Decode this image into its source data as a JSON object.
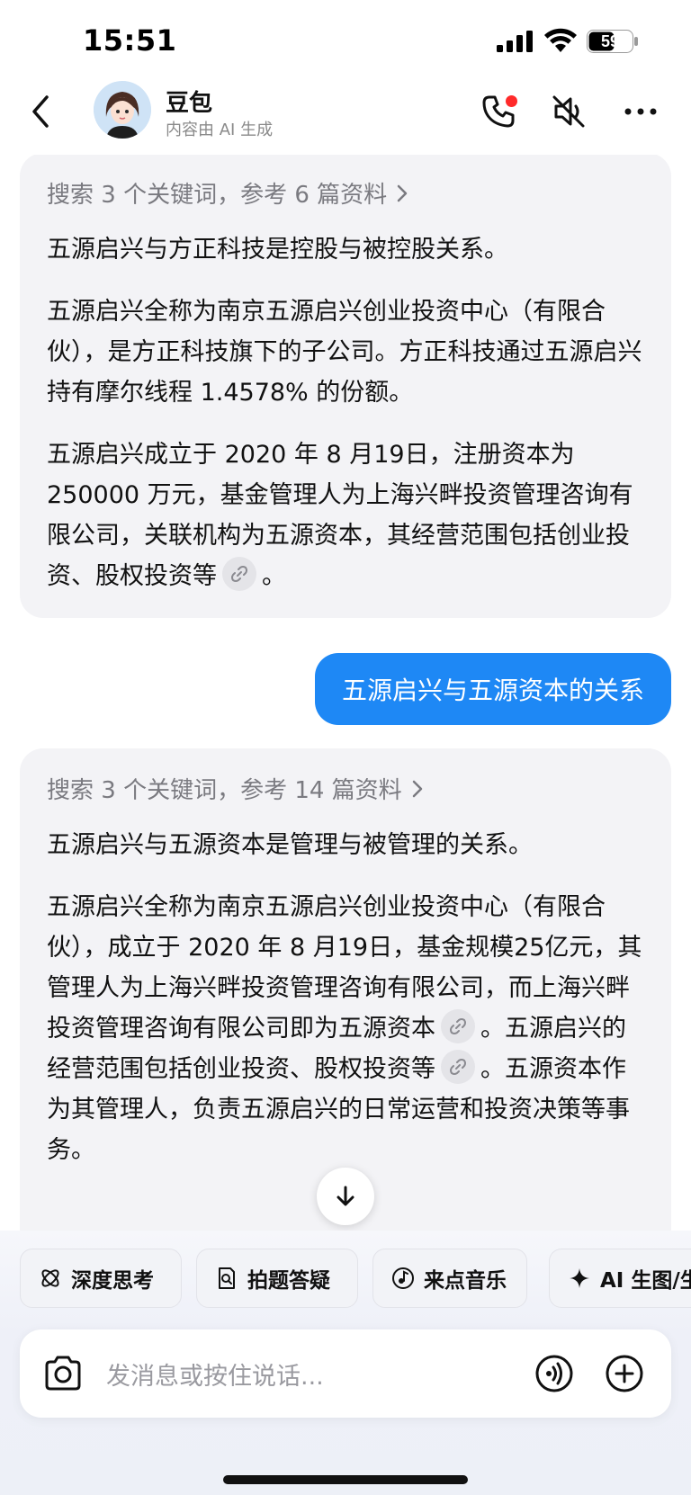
{
  "status_bar": {
    "time": "15:51",
    "battery": "59"
  },
  "header": {
    "name": "豆包",
    "subtitle": "内容由 AI 生成"
  },
  "messages": {
    "ai1": {
      "search": "搜索 3 个关键词，参考 6 篇资料",
      "p1": "五源启兴与方正科技是控股与被控股关系。",
      "p2": "五源启兴全称为南京五源启兴创业投资中心（有限合伙），是方正科技旗下的子公司。方正科技通过五源启兴持有摩尔线程 1.4578% 的份额。",
      "p3": "五源启兴成立于 2020 年 8 月19日，注册资本为250000 万元，基金管理人为上海兴畔投资管理咨询有限公司，关联机构为五源资本，其经营范围包括创业投资、股权投资等",
      "p3_end": "。"
    },
    "user1": "五源启兴与五源资本的关系",
    "ai2": {
      "search": "搜索 3 个关键词，参考 14 篇资料",
      "p1": "五源启兴与五源资本是管理与被管理的关系。",
      "p2a": "五源启兴全称为南京五源启兴创业投资中心（有限合伙），成立于 2020 年 8 月19日，基金规模25亿元，其管理人为上海兴畔投资管理咨询有限公司，而上海兴畔投资管理咨询有限公司即为五源资本",
      "p2b": "。五源启兴的经营范围包括创业投资、股权投资等",
      "p2c": "。五源资本作为其管理人，负责五源启兴的日常运营和投资决策等事务。"
    }
  },
  "chips": [
    "深度思考",
    "拍题答疑",
    "来点音乐",
    "AI 生图/生"
  ],
  "input": {
    "placeholder": "发消息或按住说话..."
  },
  "colors": {
    "user_bubble": "#1e88f5",
    "ai_bubble": "#f3f3f6",
    "call_dot": "#ff2a2a"
  }
}
